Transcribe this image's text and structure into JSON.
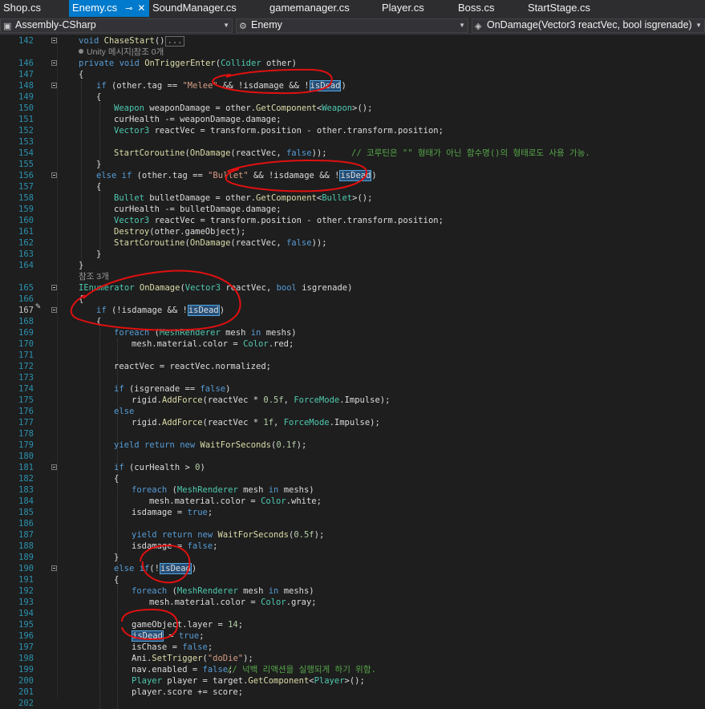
{
  "tabs": [
    {
      "label": "Shop.cs",
      "active": false
    },
    {
      "label": "Enemy.cs",
      "active": true,
      "pin": "⊸",
      "close": "✕"
    },
    {
      "label": "SoundManager.cs",
      "active": false
    },
    {
      "label": "gamemanager.cs",
      "active": false
    },
    {
      "label": "Player.cs",
      "active": false
    },
    {
      "label": "Boss.cs",
      "active": false
    },
    {
      "label": "StartStage.cs",
      "active": false
    }
  ],
  "navbar": {
    "project": "Assembly-CSharp",
    "class_name": "Enemy",
    "member": "OnDamage(Vector3 reactVec, bool isgrenade)"
  },
  "icons": {
    "project": "csharp-project-icon",
    "class": "class-icon",
    "member": "method-icon",
    "margin": "edit-pencil-icon"
  },
  "colors": {
    "keyword": "#569cd6",
    "type": "#4ec9b0",
    "string": "#d69d85",
    "comment": "#57a64a",
    "line_number": "#2b91af",
    "ink": "#e01010",
    "active_tab": "#007acc"
  },
  "codelens": [
    {
      "text": "Unity 메시지|참조 0개",
      "after_line": "142"
    },
    {
      "text": "참조 3개",
      "after_line": "164"
    }
  ],
  "lines": [
    {
      "num": "142",
      "code": "void ChaseStart()"
    },
    {
      "num": "146",
      "code": "private void OnTriggerEnter(Collider other)"
    },
    {
      "num": "147",
      "code": "{"
    },
    {
      "num": "148",
      "code": "if (other.tag == \"Melee\" && !isdamage && !isDead)"
    },
    {
      "num": "149",
      "code": "{"
    },
    {
      "num": "150",
      "code": "Weapon weaponDamage = other.GetComponent<Weapon>();"
    },
    {
      "num": "151",
      "code": "curHealth -= weaponDamage.damage;"
    },
    {
      "num": "152",
      "code": "Vector3 reactVec = transform.position - other.transform.position;"
    },
    {
      "num": "153",
      "code": ""
    },
    {
      "num": "154",
      "code": "StartCoroutine(OnDamage(reactVec, false));",
      "comment": "// 코루틴은 \"\" 형태가 아닌 함수명()의 형태로도 사용 가능."
    },
    {
      "num": "155",
      "code": "}"
    },
    {
      "num": "156",
      "code": "else if (other.tag == \"Bullet\" && !isdamage && !isDead)"
    },
    {
      "num": "157",
      "code": "{"
    },
    {
      "num": "158",
      "code": "Bullet bulletDamage = other.GetComponent<Bullet>();"
    },
    {
      "num": "159",
      "code": "curHealth -= bulletDamage.damage;"
    },
    {
      "num": "160",
      "code": "Vector3 reactVec = transform.position - other.transform.position;"
    },
    {
      "num": "161",
      "code": "Destroy(other.gameObject);"
    },
    {
      "num": "162",
      "code": "StartCoroutine(OnDamage(reactVec, false));"
    },
    {
      "num": "163",
      "code": "}"
    },
    {
      "num": "164",
      "code": "}"
    },
    {
      "num": "165",
      "code": "IEnumerator OnDamage(Vector3 reactVec, bool isgrenade)"
    },
    {
      "num": "166",
      "code": "{"
    },
    {
      "num": "167",
      "code": "if (!isdamage && !isDead)"
    },
    {
      "num": "168",
      "code": "{"
    },
    {
      "num": "169",
      "code": "foreach (MeshRenderer mesh in meshs)"
    },
    {
      "num": "170",
      "code": "mesh.material.color = Color.red;"
    },
    {
      "num": "171",
      "code": ""
    },
    {
      "num": "172",
      "code": "reactVec = reactVec.normalized;"
    },
    {
      "num": "173",
      "code": ""
    },
    {
      "num": "174",
      "code": "if (isgrenade == false)"
    },
    {
      "num": "175",
      "code": "rigid.AddForce(reactVec * 0.5f, ForceMode.Impulse);"
    },
    {
      "num": "176",
      "code": "else"
    },
    {
      "num": "177",
      "code": "rigid.AddForce(reactVec * 1f, ForceMode.Impulse);"
    },
    {
      "num": "178",
      "code": ""
    },
    {
      "num": "179",
      "code": "yield return new WaitForSeconds(0.1f);"
    },
    {
      "num": "180",
      "code": ""
    },
    {
      "num": "181",
      "code": "if (curHealth > 0)"
    },
    {
      "num": "182",
      "code": "{"
    },
    {
      "num": "183",
      "code": "foreach (MeshRenderer mesh in meshs)"
    },
    {
      "num": "184",
      "code": "mesh.material.color = Color.white;"
    },
    {
      "num": "185",
      "code": "isdamage = true;"
    },
    {
      "num": "186",
      "code": ""
    },
    {
      "num": "187",
      "code": "yield return new WaitForSeconds(0.5f);"
    },
    {
      "num": "188",
      "code": "isdamage = false;"
    },
    {
      "num": "189",
      "code": "}"
    },
    {
      "num": "190",
      "code": "else if(!isDead)"
    },
    {
      "num": "191",
      "code": "{"
    },
    {
      "num": "192",
      "code": "foreach (MeshRenderer mesh in meshs)"
    },
    {
      "num": "193",
      "code": "mesh.material.color = Color.gray;"
    },
    {
      "num": "194",
      "code": ""
    },
    {
      "num": "195",
      "code": "gameObject.layer = 14;"
    },
    {
      "num": "196",
      "code": "isDead = true;"
    },
    {
      "num": "197",
      "code": "isChase = false;"
    },
    {
      "num": "198",
      "code": "Ani.SetTrigger(\"doDie\");"
    },
    {
      "num": "199",
      "code": "nav.enabled = false;",
      "comment": "// 넉백 리액션을 실행되게 하기 위함."
    },
    {
      "num": "200",
      "code": "Player player = target.GetComponent<Player>();"
    },
    {
      "num": "201",
      "code": "player.score += score;"
    },
    {
      "num": "202",
      "code": ""
    }
  ]
}
